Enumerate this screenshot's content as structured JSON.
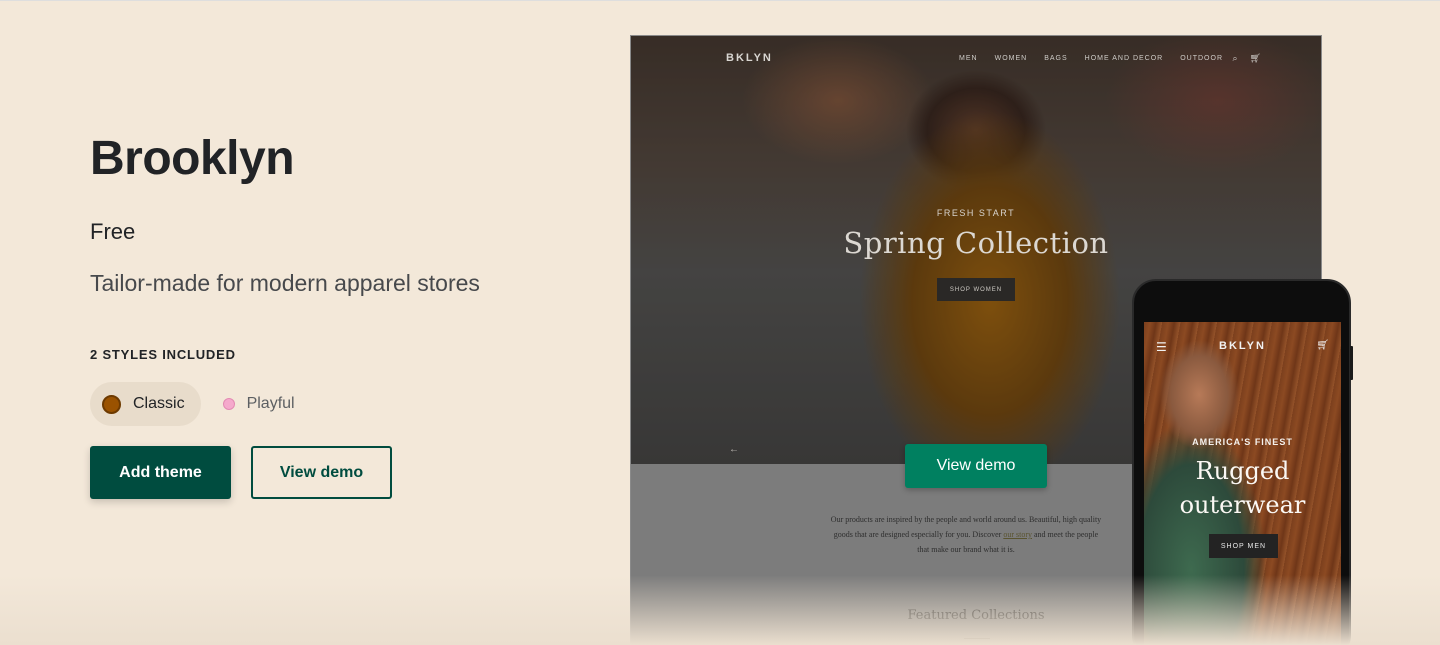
{
  "theme": {
    "name": "Brooklyn",
    "price": "Free",
    "tagline": "Tailor-made for modern apparel stores"
  },
  "styles": {
    "heading": "2 STYLES INCLUDED",
    "options": [
      {
        "label": "Classic",
        "color": "#9a5200",
        "selected": true
      },
      {
        "label": "Playful",
        "color": "#f5a9cc",
        "selected": false
      }
    ]
  },
  "actions": {
    "add_theme": "Add theme",
    "view_demo": "View demo"
  },
  "desktop_preview": {
    "logo": "BKLYN",
    "nav": [
      "MEN",
      "WOMEN",
      "BAGS",
      "HOME AND DECOR",
      "OUTDOOR"
    ],
    "hero_eyebrow": "FRESH START",
    "hero_title": "Spring Collection",
    "hero_button": "SHOP WOMEN",
    "intro_line1": "Our products are inspired by the people and world around us. Beautiful, high quality",
    "intro_line2_a": "goods that are designed especially for you. Discover",
    "intro_link": "our story",
    "intro_line2_b": "and meet the people",
    "intro_line3": "that make our brand what it is.",
    "featured_heading": "Featured Collections",
    "overlay_button": "View demo"
  },
  "mobile_preview": {
    "logo": "BKLYN",
    "eyebrow": "AMERICA'S FINEST",
    "title_line1": "Rugged",
    "title_line2": "outerwear",
    "button": "SHOP MEN"
  },
  "colors": {
    "background": "#f3e8d9",
    "primary": "#004c3f",
    "demo_button": "#008060"
  },
  "icons": {
    "search": "search-icon",
    "cart": "cart-icon",
    "menu": "hamburger-icon",
    "arrow": "arrow-left-icon"
  }
}
